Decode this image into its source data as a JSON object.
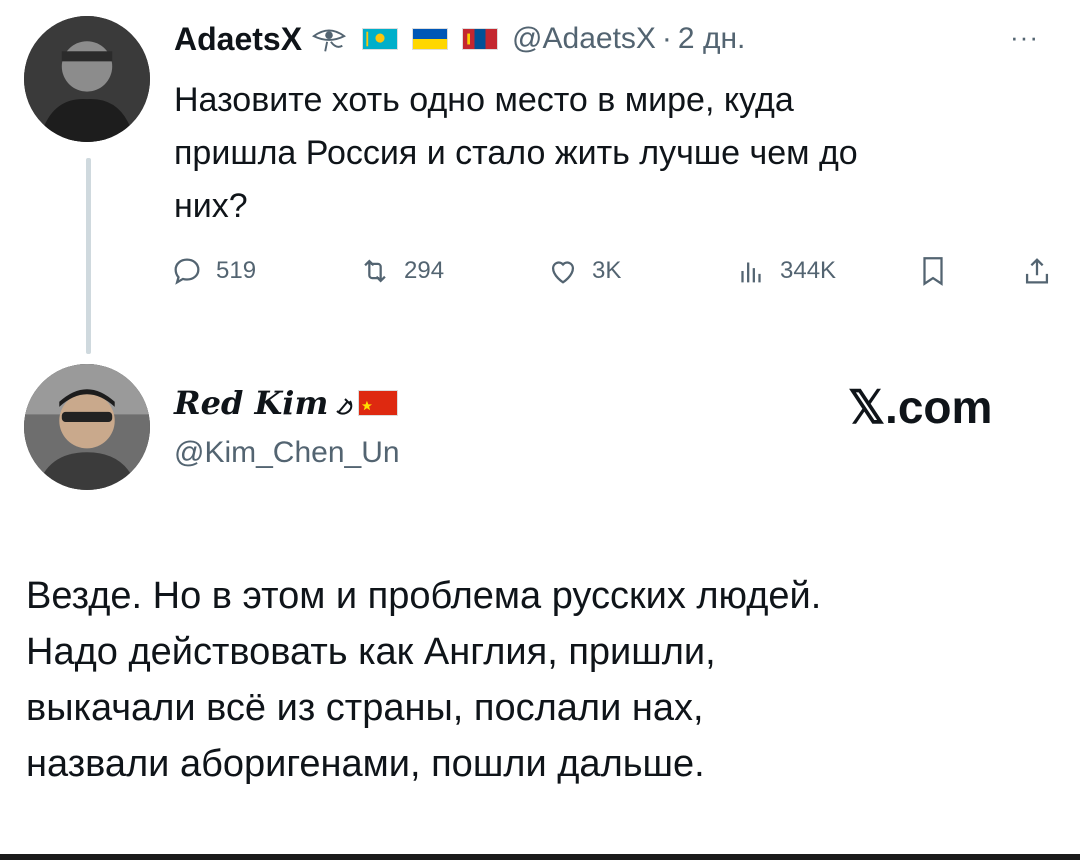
{
  "tweet": {
    "author_name": "AdaetsX",
    "verified_icon": "eye-of-horus-icon",
    "flags": [
      "flag-kazakhstan-icon",
      "flag-ukraine-icon",
      "flag-mongolia-icon"
    ],
    "handle": "@AdaetsX",
    "separator": "·",
    "time": "2 дн.",
    "more_label": "···",
    "text_lines": [
      "Назовите хоть одно место в мире, куда",
      "пришла Россия и стало жить лучше чем до",
      "них?"
    ],
    "actions": {
      "replies": "519",
      "reposts": "294",
      "likes": "3K",
      "views": "344K"
    }
  },
  "reply": {
    "author_name": "Red Kim",
    "name_icons": [
      "hammer-sickle-icon",
      "flag-china-icon"
    ],
    "handle": "@Kim_Chen_Un",
    "watermark": "𝕏.com",
    "text_lines": [
      "Везде. Но в этом и проблема русских людей.",
      "Надо действовать как Англия, пришли,",
      "выкачали всё из страны, послали нах,",
      "назвали аборигенами, пошли дальше."
    ]
  },
  "colors": {
    "text": "#0f1419",
    "secondary": "#536471",
    "thread_line": "#cfd9de"
  }
}
